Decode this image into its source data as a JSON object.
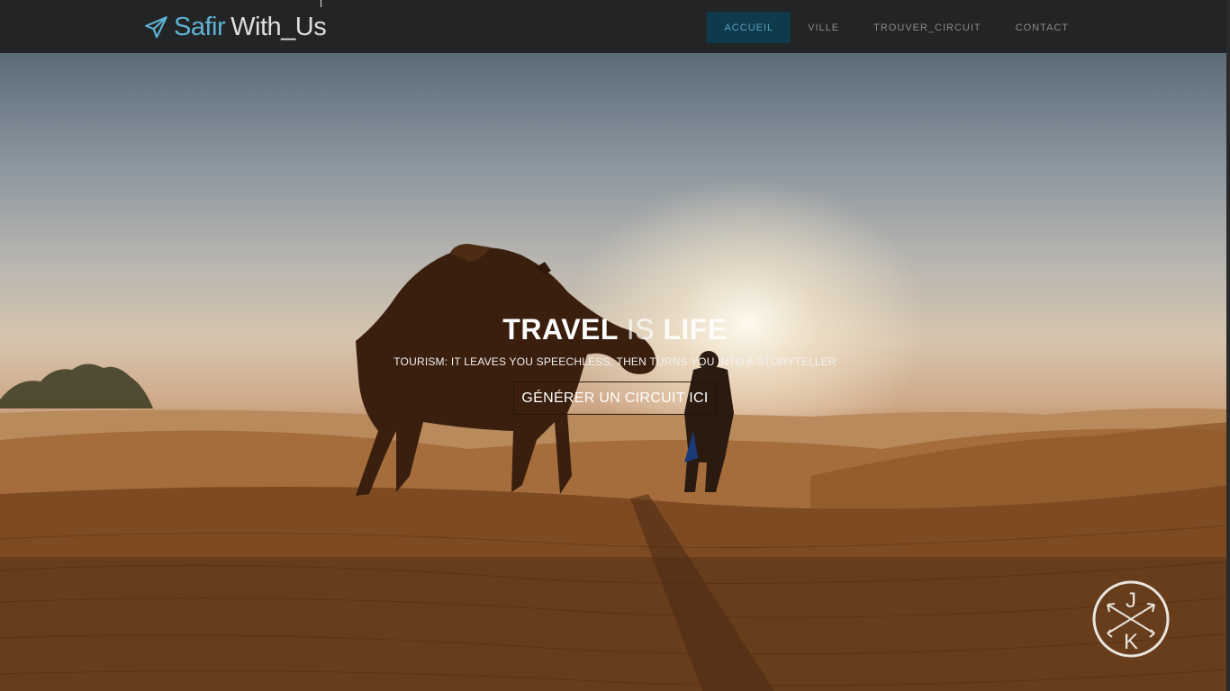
{
  "navbar": {
    "brand": {
      "icon": "paper-plane-icon",
      "name_part1": "Safir",
      "name_part2": "With_Us",
      "color_part1": "#5fb2d3"
    },
    "items": [
      {
        "label": "ACCUEIL",
        "active": true
      },
      {
        "label": "VILLE",
        "active": false
      },
      {
        "label": "TROUVER_CIRCUIT",
        "active": false
      },
      {
        "label": "CONTACT",
        "active": false
      }
    ]
  },
  "hero": {
    "background": "desert-camel-sunset",
    "title_part1": "TRAVEL",
    "title_part2": "IS",
    "title_part3": "LIFE",
    "subtitle": "TOURISM: IT LEAVES YOU SPEECHLESS, THEN TURNS YOU INTO A STORYTELLER",
    "cta_label": "GÉNÉRER UN CIRCUIT ICI"
  },
  "watermark": {
    "icon": "jk-crossed-arrows-logo",
    "letter_top": "J",
    "letter_bottom": "K"
  },
  "colors": {
    "navbar_bg": "#232425",
    "active_nav_bg": "#0e3a4c",
    "active_nav_text": "#5aa2bf"
  }
}
